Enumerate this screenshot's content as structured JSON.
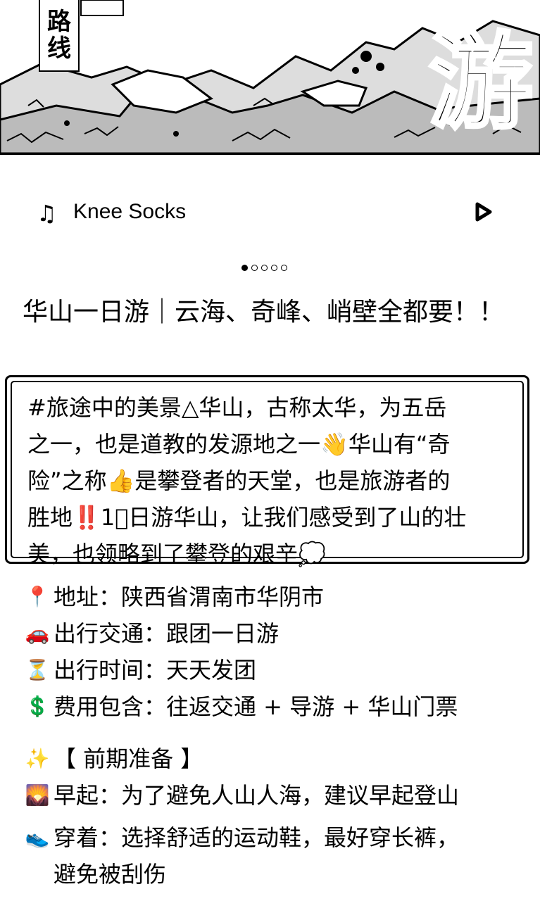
{
  "hero": {
    "tag_line1": "路",
    "tag_line2": "线",
    "big_char": "游"
  },
  "music": {
    "note_icon": "music-note-icon",
    "title": "Knee Socks",
    "play_icon": "play-icon"
  },
  "carousel": {
    "count": 5,
    "active": 0
  },
  "post": {
    "title": "华山一日游｜云海、奇峰、峭壁全都要！！",
    "boxed": {
      "lines": [
        "#旅途中的美景△华山，古称太华，为五岳",
        "之一，也是道教的发源地之一👋华山有“奇",
        "险”之称👍是攀登者的天堂，也是旅游者的",
        "胜地‼️1⃣日游华山，让我们感受到了山的壮",
        "美，也领略到了攀登的艰辛💭"
      ]
    },
    "details": [
      {
        "icon": "📍",
        "text": "地址：陕西省渭南市华阴市"
      },
      {
        "icon": "🚗",
        "text": "出行交通：跟团一日游"
      },
      {
        "icon": "⏳",
        "text": "出行时间：天天发团"
      },
      {
        "icon": "💲",
        "text": "费用包含：往返交通 + 导游 + 华山门票"
      }
    ],
    "prep_title": {
      "icon": "✨",
      "text": "【 前期准备 】"
    },
    "prep_items": [
      {
        "icon": "🌄",
        "text": "早起：为了避免人山人海，建议早起登山"
      },
      {
        "icon": "👟",
        "text": "穿着：选择舒适的运动鞋，最好穿长裤，"
      },
      {
        "icon": "",
        "text": "避免被刮伤"
      }
    ]
  }
}
